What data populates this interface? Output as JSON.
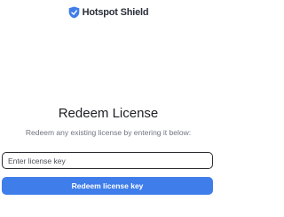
{
  "brand": {
    "name": "Hotspot Shield",
    "logo_icon": "shield-logo-icon",
    "color": "#3f7dea"
  },
  "main": {
    "title": "Redeem License",
    "subtitle": "Redeem any existing license by entering it below:"
  },
  "form": {
    "license_input": {
      "placeholder": "Enter license key",
      "value": ""
    },
    "redeem_button_label": "Redeem license key",
    "button_color": "#3f7dea"
  }
}
